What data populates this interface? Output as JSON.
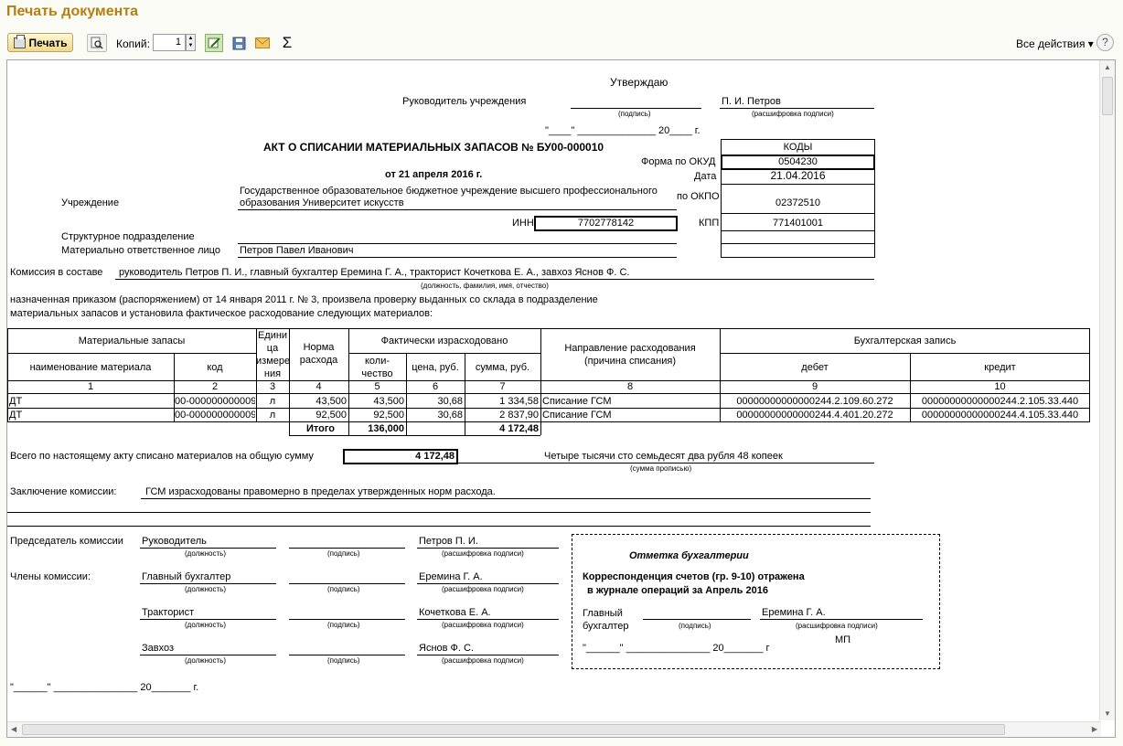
{
  "window": {
    "title": "Печать документа"
  },
  "toolbar": {
    "print_label": "Печать",
    "copies_label": "Копий:",
    "copies_value": "1",
    "sum_glyph": "Σ",
    "all_actions_label": "Все действия ▾",
    "help_glyph": "?"
  },
  "doc": {
    "approve": "Утверждаю",
    "head_label": "Руководитель учреждения",
    "head_name": "П. И. Петров",
    "sig_hint": "(подпись)",
    "decode_hint": "(расшифровка подписи)",
    "date_line": "\"____\" ______________ 20____ г.",
    "title": "АКТ О СПИСАНИИ МАТЕРИАЛЬНЫХ ЗАПАСОВ  № БУ00-000010",
    "date_title": "от 21 апреля 2016 г.",
    "codes_header": "КОДЫ",
    "form_label": "Форма  по ОКУД",
    "okud": "0504230",
    "date_label": "Дата",
    "date_value": "21.04.2016",
    "okpo_label": "по ОКПО",
    "okpo": "02372510",
    "inn_label": "ИНН",
    "inn": "7702778142",
    "kpp_label": "КПП",
    "kpp": "771401001",
    "institution_label": "Учреждение",
    "institution_line1": "Государственное образовательное бюджетное учреждение высшего профессионального",
    "institution_line2": "образования  Университет искусств",
    "subdivision_label": "Структурное подразделение",
    "mol_label": "Материально ответственное лицо",
    "mol_name": "Петров Павел Иванович",
    "commission_label": "Комиссия в составе",
    "commission_value": "руководитель Петров П. И., главный бухгалтер Еремина Г. А., тракторист Кочеткова Е. А., завхоз Яснов Ф. С.",
    "commission_hint": "(должность, фамилия, имя, отчество)",
    "order_line1": "назначенная приказом (распоряжением)  от  14 января 2011 г. №  3, произвела проверку выданных со склада в подразделение",
    "order_line2": "материальных запасов и установила фактическое расходование следующих материалов:",
    "table": {
      "h_materials": "Материальные запасы",
      "h_name": "наименование материала",
      "h_code": "код",
      "h_unit": [
        "Едини",
        "ца",
        "измере",
        "ния"
      ],
      "h_norm": [
        "Норма",
        "расхода"
      ],
      "h_actual": "Фактически израсходовано",
      "h_qty": [
        "коли-",
        "чество"
      ],
      "h_price": "цена, руб.",
      "h_sum": "сумма, руб.",
      "h_direction": [
        "Направление расходования",
        "(причина списания)"
      ],
      "h_accounting": "Бухгалтерская запись",
      "h_debit": "дебет",
      "h_credit": "кредит",
      "col_numbers": [
        "1",
        "2",
        "3",
        "4",
        "5",
        "6",
        "7",
        "8",
        "9",
        "10"
      ],
      "rows": [
        [
          "ДТ",
          "00-000000000009",
          "л",
          "43,500",
          "43,500",
          "30,68",
          "1 334,58",
          "Списание ГСМ",
          "00000000000000244.2.109.60.272",
          "00000000000000244.2.105.33.440"
        ],
        [
          "ДТ",
          "00-000000000009",
          "л",
          "92,500",
          "92,500",
          "30,68",
          "2 837,90",
          "Списание ГСМ",
          "00000000000000244.4.401.20.272",
          "00000000000000244.4.105.33.440"
        ]
      ],
      "total_label": "Итого",
      "total_qty": "136,000",
      "total_sum": "4 172,48"
    },
    "total_text": "Всего по настоящему акту списано материалов на общую сумму",
    "total_amount": "4 172,48",
    "total_words": "Четыре тысячи сто семьдесят два рубля 48 копеек",
    "total_words_hint": "(сумма прописью)",
    "conclusion_label": "Заключение комиссии:",
    "conclusion_value": "ГСМ израсходованы правомерно в пределах утвержденных норм расхода.",
    "chairman_label": "Председатель комиссии",
    "members_label": "Члены комиссии:",
    "position_hint": "(должность)",
    "signers": [
      {
        "position": "Руководитель",
        "name": "Петров П. И."
      },
      {
        "position": "Главный бухгалтер",
        "name": "Еремина Г. А."
      },
      {
        "position": "Тракторист",
        "name": "Кочеткова Е. А."
      },
      {
        "position": "Завхоз",
        "name": "Яснов Ф. С."
      }
    ],
    "bottom_date": "\"______\" _______________ 20_______ г.",
    "acc_title": "Отметка бухгалтерии",
    "acc_line1": "Корреспонденция счетов (гр. 9-10) отражена",
    "acc_line2": "в журнале операций за Апрель 2016",
    "acc_chief1": "Главный",
    "acc_chief2": "бухгалтер",
    "acc_chief_name": "Еремина Г. А.",
    "acc_mp": "МП",
    "acc_date": "\"______\" _______________ 20_______ г"
  }
}
